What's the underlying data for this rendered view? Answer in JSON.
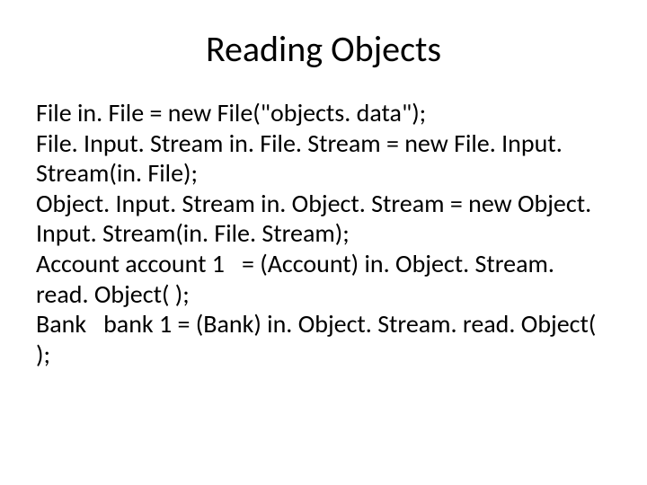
{
  "slide": {
    "title": "Reading Objects",
    "body": "File in. File = new File(\"objects. data\");\nFile. Input. Stream in. File. Stream = new File. Input. Stream(in. File);\nObject. Input. Stream in. Object. Stream = new Object. Input. Stream(in. File. Stream);\nAccount account 1   = (Account) in. Object. Stream. read. Object( );\nBank   bank 1 = (Bank) in. Object. Stream. read. Object( );"
  }
}
